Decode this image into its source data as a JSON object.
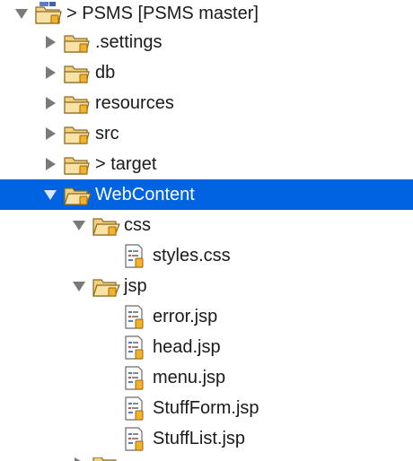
{
  "tree": {
    "project": {
      "label": "> PSMS [PSMS master]"
    },
    "settings": {
      "label": ".settings"
    },
    "db": {
      "label": "db"
    },
    "resources": {
      "label": "resources"
    },
    "src": {
      "label": "src"
    },
    "target": {
      "label": "> target"
    },
    "webcontent": {
      "label": "WebContent"
    },
    "css": {
      "label": "css"
    },
    "styles_css": {
      "label": "styles.css"
    },
    "jsp": {
      "label": "jsp"
    },
    "error_jsp": {
      "label": "error.jsp"
    },
    "head_jsp": {
      "label": "head.jsp"
    },
    "menu_jsp": {
      "label": "menu.jsp"
    },
    "stuffform_jsp": {
      "label": "StuffForm.jsp"
    },
    "stufflist_jsp": {
      "label": "StuffList.jsp"
    }
  },
  "colors": {
    "selection": "#0063e1",
    "folder_fill": "#f5d58c",
    "folder_stroke": "#8a6a21",
    "twisty": "#7a7a7a"
  },
  "icons": {
    "folder": "folder-icon",
    "file": "file-icon",
    "project": "project-icon",
    "expand": "triangle-right-icon",
    "collapse": "triangle-down-icon"
  }
}
